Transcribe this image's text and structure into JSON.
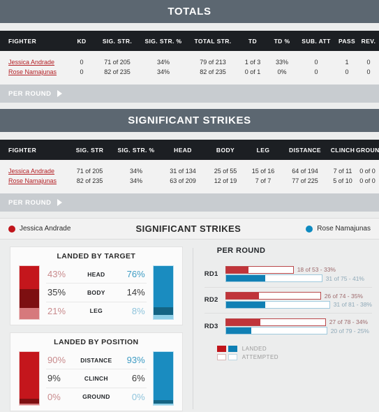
{
  "totals": {
    "title": "TOTALS",
    "columns": [
      "FIGHTER",
      "KD",
      "SIG. STR.",
      "SIG. STR. %",
      "TOTAL STR.",
      "TD",
      "TD %",
      "SUB. ATT",
      "PASS",
      "REV."
    ],
    "rows": [
      {
        "fighter": "Jessica Andrade",
        "kd": "0",
        "sig_str": "71 of 205",
        "sig_str_pct": "34%",
        "total_str": "79 of 213",
        "td": "1 of 3",
        "td_pct": "33%",
        "sub_att": "0",
        "pass": "1",
        "rev": "0"
      },
      {
        "fighter": "Rose Namajunas",
        "kd": "0",
        "sig_str": "82 of 235",
        "sig_str_pct": "34%",
        "total_str": "82 of 235",
        "td": "0 of 1",
        "td_pct": "0%",
        "sub_att": "0",
        "pass": "0",
        "rev": "0"
      }
    ],
    "per_round_label": "PER ROUND"
  },
  "significant_strikes": {
    "title": "SIGNIFICANT STRIKES",
    "columns": [
      "FIGHTER",
      "SIG. STR",
      "SIG. STR. %",
      "HEAD",
      "BODY",
      "LEG",
      "DISTANCE",
      "CLINCH",
      "GROUND"
    ],
    "rows": [
      {
        "fighter": "Jessica Andrade",
        "sig_str": "71 of 205",
        "sig_str_pct": "34%",
        "head": "31 of 134",
        "body": "25 of 55",
        "leg": "15 of 16",
        "distance": "64 of 194",
        "clinch": "7 of 11",
        "ground": "0 of 0"
      },
      {
        "fighter": "Rose Namajunas",
        "sig_str": "82 of 235",
        "sig_str_pct": "34%",
        "head": "63 of 209",
        "body": "12 of 19",
        "leg": "7 of 7",
        "distance": "77 of 225",
        "clinch": "5 of 10",
        "ground": "0 of 0"
      }
    ],
    "per_round_label": "PER ROUND"
  },
  "chart_panel": {
    "left_fighter": "Jessica Andrade",
    "right_fighter": "Rose Namajunas",
    "center_title": "SIGNIFICANT STRIKES",
    "left_color": "#c0151b",
    "right_color": "#0e8ac0"
  },
  "chart_data": [
    {
      "type": "bar",
      "title": "LANDED BY TARGET",
      "categories": [
        "HEAD",
        "BODY",
        "LEG"
      ],
      "series": [
        {
          "name": "Jessica Andrade",
          "values": [
            43,
            35,
            21
          ],
          "labels": [
            "43%",
            "35%",
            "21%"
          ],
          "colors": [
            "#c4161c",
            "#7d0f11",
            "#d6797c"
          ]
        },
        {
          "name": "Rose Namajunas",
          "values": [
            76,
            14,
            8
          ],
          "labels": [
            "76%",
            "14%",
            "8%"
          ],
          "colors": [
            "#1a8cc0",
            "#146484",
            "#8fd0e8"
          ]
        }
      ],
      "ylim": [
        0,
        100
      ],
      "grid": false,
      "legend": "none"
    },
    {
      "type": "bar",
      "title": "LANDED BY POSITION",
      "categories": [
        "DISTANCE",
        "CLINCH",
        "GROUND"
      ],
      "series": [
        {
          "name": "Jessica Andrade",
          "values": [
            90,
            9,
            0
          ],
          "labels": [
            "90%",
            "9%",
            "0%"
          ],
          "colors": [
            "#c4161c",
            "#7d0f11",
            "#d6797c"
          ]
        },
        {
          "name": "Rose Namajunas",
          "values": [
            93,
            6,
            0
          ],
          "labels": [
            "93%",
            "6%",
            "0%"
          ],
          "colors": [
            "#1a8cc0",
            "#146484",
            "#8fd0e8"
          ]
        }
      ],
      "ylim": [
        0,
        100
      ],
      "grid": false,
      "legend": "none"
    },
    {
      "type": "bar",
      "title": "PER ROUND",
      "orientation": "horizontal",
      "categories": [
        "RD1",
        "RD2",
        "RD3"
      ],
      "rounds": [
        {
          "round": "RD1",
          "red": {
            "landed": 18,
            "attempted": 53,
            "pct": "33%",
            "text": "18 of 53 - 33%"
          },
          "blue": {
            "landed": 31,
            "attempted": 75,
            "pct": "41%",
            "text": "31 of 75 - 41%"
          }
        },
        {
          "round": "RD2",
          "red": {
            "landed": 26,
            "attempted": 74,
            "pct": "35%",
            "text": "26 of 74 - 35%"
          },
          "blue": {
            "landed": 31,
            "attempted": 81,
            "pct": "38%",
            "text": "31 of 81 - 38%"
          }
        },
        {
          "round": "RD3",
          "red": {
            "landed": 27,
            "attempted": 78,
            "pct": "34%",
            "text": "27 of 78 - 34%"
          },
          "blue": {
            "landed": 20,
            "attempted": 79,
            "pct": "25%",
            "text": "20 of 79 - 25%"
          }
        }
      ],
      "legend": [
        "LANDED",
        "ATTEMPTED"
      ],
      "legend_position": "bottom-left"
    }
  ],
  "per_round_legend": {
    "landed": "LANDED",
    "attempted": "ATTEMPTED"
  }
}
